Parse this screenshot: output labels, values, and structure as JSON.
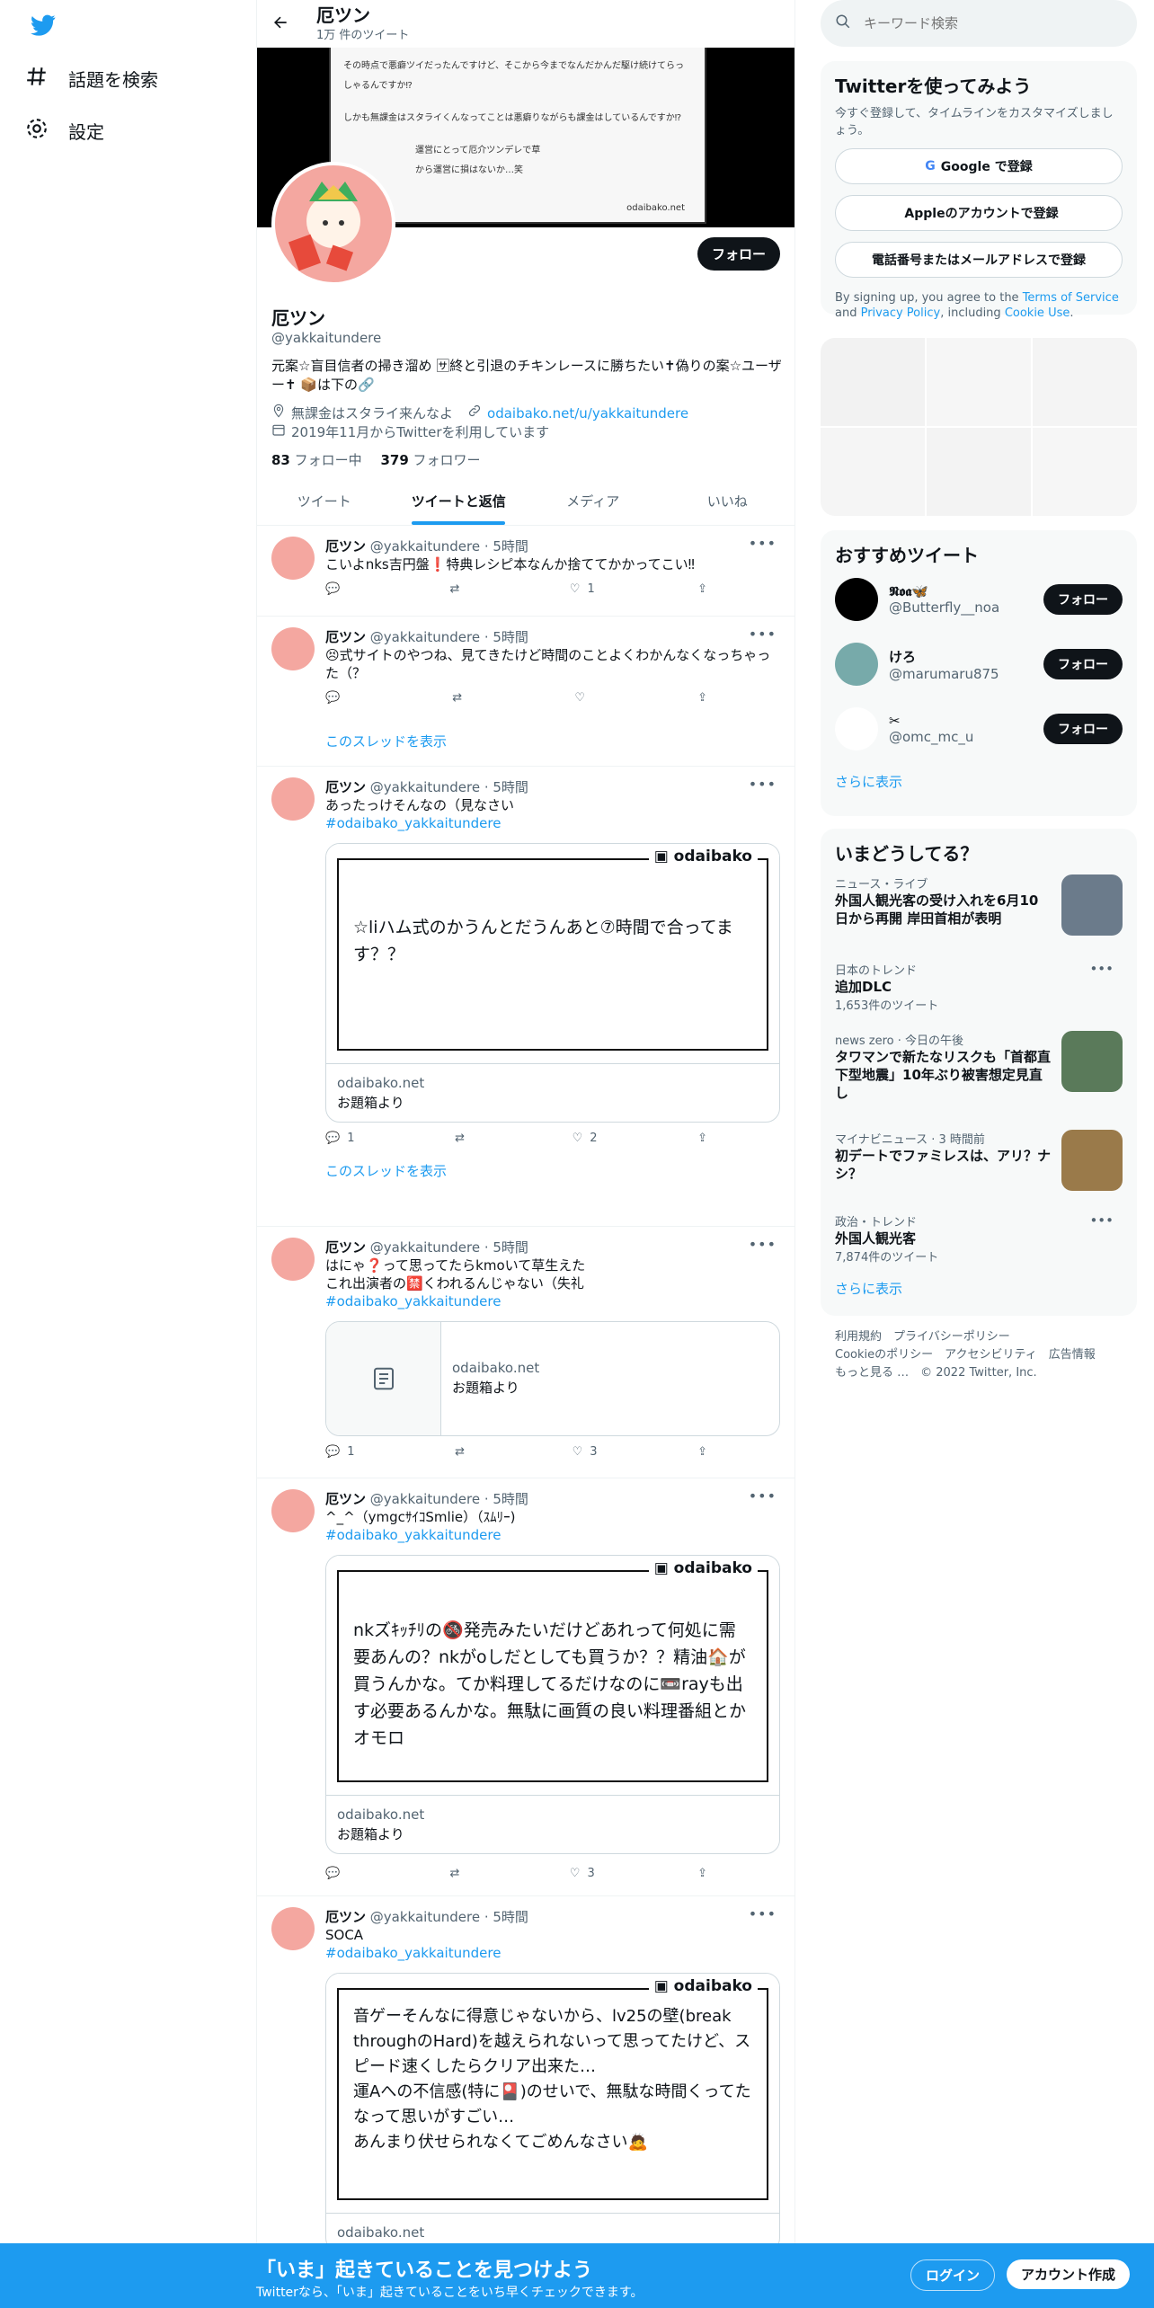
{
  "nav": {
    "explore": "話題を検索",
    "settings": "設定"
  },
  "profile": {
    "name": "厄ツン",
    "tweet_count": "1万 件のツイート",
    "handle": "@yakkaitundere",
    "bio": "元案☆盲目信者の掃き溜め 🈂終と引退のチキンレースに勝ちたい✝偽りの案☆ユーザー✝ 📦は下の🔗",
    "location": "無課金はスタライ来んなよ",
    "link": "odaibako.net/u/yakkaitundere",
    "joined": "2019年11月からTwitterを利用しています",
    "following_num": "83",
    "following_label": "フォロー中",
    "followers_num": "379",
    "followers_label": "フォロワー",
    "follow": "フォロー",
    "banner_lines": [
      "その時点で悪癖ツイだったんですけど、そこから今までなんだかんだ駆け続けてらっしゃるんですか⁉",
      "しかも無課金はスタライくんなってことは悪癖りながらも課金はしているんですか⁉",
      "運営にとって厄介ツンデレで草",
      "から運営に損はないか…笑"
    ],
    "banner_site": "odaibako.net"
  },
  "tabs": [
    "ツイート",
    "ツイートと返信",
    "メディア",
    "いいね"
  ],
  "tweets": [
    {
      "name": "厄ツン",
      "handle": "@yakkaitundere",
      "time": "5時間",
      "text": "こいよnks吉円盤❗特典レシピ本なんか捨ててかかってこい‼",
      "reply": "",
      "rt": "",
      "like": "1"
    },
    {
      "name": "厄ツン",
      "handle": "@yakkaitundere",
      "time": "5時間",
      "text": "😣式サイトのやつね、見てきたけど時間のことよくわかんなくなっちゃった（？",
      "reply": "",
      "rt": "",
      "like": "",
      "thread": "このスレッドを表示"
    },
    {
      "name": "厄ツン",
      "handle": "@yakkaitundere",
      "time": "5時間",
      "text": "あったっけそんなの（見なさい",
      "tag": "#odaibako_yakkaitundere",
      "card_text": "☆liハム式のかうんとだうんあと⑦時間で合ってます？？",
      "card_site": "odaibako.net",
      "card_title": "お題箱より",
      "reply": "1",
      "rt": "",
      "like": "2",
      "thread": "このスレッドを表示"
    },
    {
      "name": "厄ツン",
      "handle": "@yakkaitundere",
      "time": "5時間",
      "text": "はにゃ❓って思ってたらkmoいて草生えた",
      "text2": "これ出演者の🈲くわれるんじゃない（失礼",
      "tag": "#odaibako_yakkaitundere",
      "card_site": "odaibako.net",
      "card_title": "お題箱より",
      "reply": "1",
      "rt": "",
      "like": "3"
    },
    {
      "name": "厄ツン",
      "handle": "@yakkaitundere",
      "time": "5時間",
      "text": "^_^（ymgcｻｲｺSmlie）（ｽﾑﾘｰ)",
      "tag": "#odaibako_yakkaitundere",
      "card_text": "nkズｷｯﾁﾘの🚳発売みたいだけどあれって何処に需要あんの？nkがoしだとしても買うか？？精油🏠が買うんかな。てか料理してるだけなのに📼rayも出す必要あるんかな。無駄に画質の良い料理番組とかオモロ",
      "card_site": "odaibako.net",
      "card_title": "お題箱より",
      "reply": "",
      "rt": "",
      "like": "3"
    },
    {
      "name": "厄ツン",
      "handle": "@yakkaitundere",
      "time": "5時間",
      "text": "SOCA",
      "tag": "#odaibako_yakkaitundere",
      "card_text": "音ゲーそんなに得意じゃないから、lv25の壁(break throughのHard)を越えられないって思ってたけど、スピード速くしたらクリア出来た…\n運Aへの不信感(特に🎴)のせいで、無駄な時間くってたなって思いがすごい…\nあんまり伏せられなくてごめんなさい🙇",
      "card_site": "odaibako.net"
    }
  ],
  "odaibako_logo": "odaibako",
  "search": {
    "placeholder": "キーワード検索"
  },
  "signup": {
    "title": "Twitterを使ってみよう",
    "sub": "今すぐ登録して、タイムラインをカスタマイズしましょう。",
    "google": "Google で登録",
    "apple": "Appleのアカウントで登録",
    "phone": "電話番号またはメールアドレスで登録",
    "legal1": "By signing up, you agree to the ",
    "terms": "Terms of Service",
    "and": " and ",
    "privacy": "Privacy Policy",
    "incl": ", including ",
    "cookie": "Cookie Use",
    "dot": "."
  },
  "recommend": {
    "title": "おすすめツイート",
    "users": [
      {
        "name": "𝕹𝖔𝖆🦋",
        "handle": "@Butterfly__noa"
      },
      {
        "name": "けろ",
        "handle": "@marumaru875"
      },
      {
        "name": "✂",
        "handle": "@omc_mc_u"
      }
    ],
    "follow": "フォロー",
    "more": "さらに表示"
  },
  "trends": {
    "title": "いまどうしてる？",
    "items": [
      {
        "cat": "ニュース・ライブ",
        "title": "外国人観光客の受け入れを6月10日から再開 岸田首相が表明"
      },
      {
        "cat": "日本のトレンド",
        "title": "追加DLC",
        "count": "1,653件のツイート"
      },
      {
        "cat": "news zero · 今日の午後",
        "title": "タワマンで新たなリスクも「首都直下型地震」10年ぶり被害想定見直し"
      },
      {
        "cat": "マイナビニュース · 3 時間前",
        "title": "初デートでファミレスは、アリ？ナシ？"
      },
      {
        "cat": "政治・トレンド",
        "title": "外国人観光客",
        "count": "7,874件のツイート"
      }
    ],
    "more": "さらに表示"
  },
  "footer": {
    "l1": "利用規約　プライバシーポリシー",
    "l2": "Cookieのポリシー　アクセシビリティ　広告情報",
    "l3": "もっと見る …　© 2022 Twitter, Inc."
  },
  "bottom": {
    "headline": "「いま」起きていることを見つけよう",
    "sub": "Twitterなら、「いま」起きていることをいち早くチェックできます。",
    "login": "ログイン",
    "signup": "アカウント作成"
  }
}
